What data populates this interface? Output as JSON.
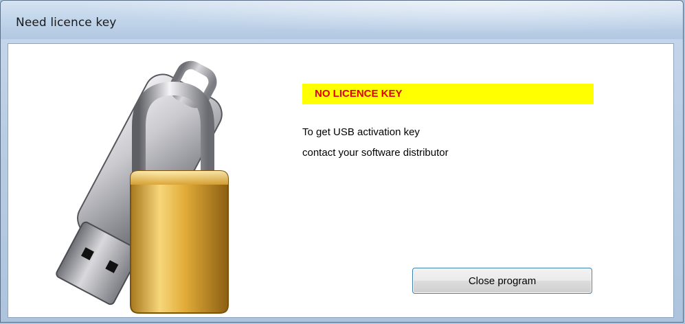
{
  "window": {
    "title": "Need licence key"
  },
  "dialog": {
    "banner_text": "NO LICENCE KEY",
    "message_line1": "To get USB activation key",
    "message_line2": "contact your software distributor",
    "close_button_label": "Close program",
    "illustration_icon": "usb-drive-padlock-icon"
  },
  "colors": {
    "banner_background": "#ffff00",
    "banner_text": "#e00000",
    "button_border": "#3c7fb1"
  }
}
